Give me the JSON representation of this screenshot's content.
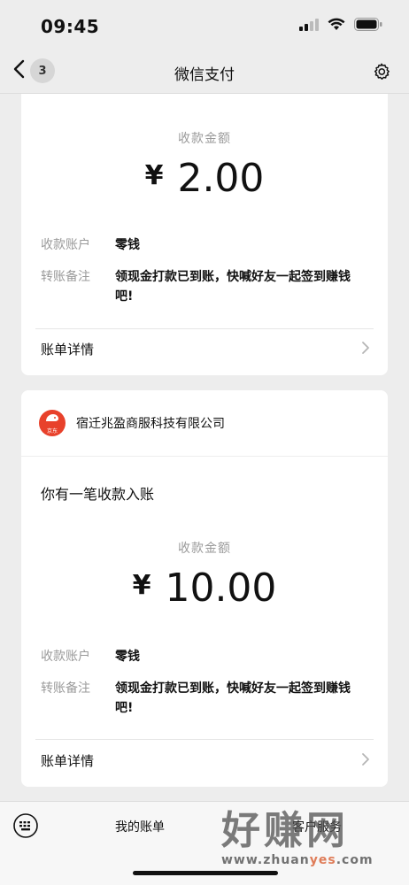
{
  "status_bar": {
    "time": "09:45"
  },
  "nav": {
    "back_count": "3",
    "title": "微信支付"
  },
  "card1": {
    "amount_label": "收款金额",
    "currency": "¥",
    "amount": "2.00",
    "account_key": "收款账户",
    "account_value": "零钱",
    "note_key": "转账备注",
    "note_value_line1": "领现金打款已到账，快喊好友一起签到赚钱",
    "note_value_line2": "吧!",
    "detail_label": "账单详情"
  },
  "card2": {
    "merchant_name": "宿迁兆盈商服科技有限公司",
    "merchant_logo_text": "京东",
    "notice": "你有一笔收款入账",
    "amount_label": "收款金额",
    "currency": "¥",
    "amount": "10.00",
    "account_key": "收款账户",
    "account_value": "零钱",
    "note_key": "转账备注",
    "note_value_line1": "领现金打款已到账，快喊好友一起签到赚钱",
    "note_value_line2": "吧!",
    "detail_label": "账单详情"
  },
  "bottom": {
    "my_bills": "我的账单",
    "service_partial": "客户服务"
  },
  "watermark": {
    "big": "好赚网",
    "small_a": "www.zhuan",
    "small_b": "yes",
    "small_c": ".com"
  },
  "colors": {
    "background": "#ededed",
    "card": "#ffffff",
    "muted": "#9a9a9a",
    "logo": "#e8412b"
  }
}
